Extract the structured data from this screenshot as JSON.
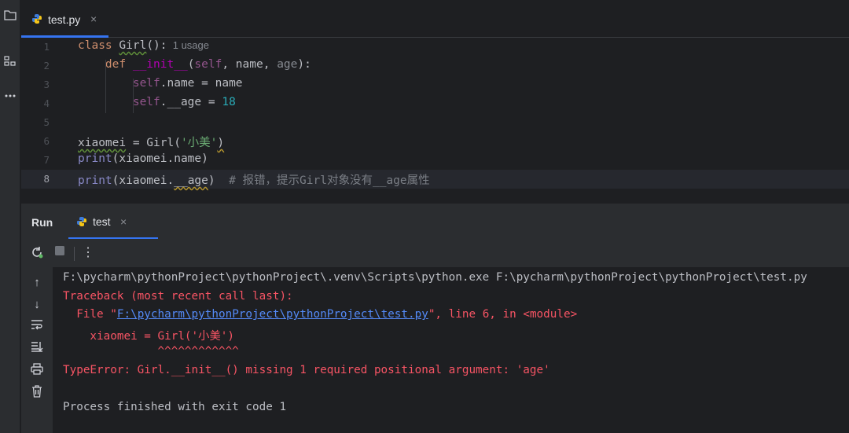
{
  "editor": {
    "tab": {
      "label": "test.py",
      "close": "×"
    },
    "lines": [
      {
        "num": "1",
        "parts": [
          {
            "t": "class ",
            "c": "kw"
          },
          {
            "t": "Girl",
            "c": "wavy-green"
          },
          {
            "t": "():",
            "c": ""
          },
          {
            "t": "  1 usage",
            "c": "hint"
          }
        ]
      },
      {
        "num": "2",
        "parts": [
          {
            "t": "    ",
            "c": ""
          },
          {
            "t": "def ",
            "c": "kw"
          },
          {
            "t": "__init__",
            "c": "dunder"
          },
          {
            "t": "(",
            "c": ""
          },
          {
            "t": "self",
            "c": "selfkw"
          },
          {
            "t": ", name, ",
            "c": ""
          },
          {
            "t": "age",
            "c": "unused"
          },
          {
            "t": "):",
            "c": ""
          }
        ]
      },
      {
        "num": "3",
        "parts": [
          {
            "t": "        ",
            "c": ""
          },
          {
            "t": "self",
            "c": "selfkw"
          },
          {
            "t": ".name = name",
            "c": ""
          }
        ]
      },
      {
        "num": "4",
        "parts": [
          {
            "t": "        ",
            "c": ""
          },
          {
            "t": "self",
            "c": "selfkw"
          },
          {
            "t": ".__age = ",
            "c": ""
          },
          {
            "t": "18",
            "c": "num"
          }
        ]
      },
      {
        "num": "5",
        "parts": []
      },
      {
        "num": "6",
        "parts": [
          {
            "t": "xiaomei",
            "c": "wavy-green"
          },
          {
            "t": " = Girl(",
            "c": ""
          },
          {
            "t": "'小美'",
            "c": "str"
          },
          {
            "t": ")",
            "c": "wavy-yellow"
          }
        ]
      },
      {
        "num": "7",
        "parts": [
          {
            "t": "print",
            "c": "builtin"
          },
          {
            "t": "(xiaomei.name)",
            "c": ""
          }
        ]
      },
      {
        "num": "8",
        "parts": [
          {
            "t": "print",
            "c": "builtin"
          },
          {
            "t": "(xiaomei.",
            "c": ""
          },
          {
            "t": "__age",
            "c": "wavy-yellow"
          },
          {
            "t": ")  ",
            "c": ""
          },
          {
            "t": "# 报错，提示Girl对象没有__age属性",
            "c": "comment"
          }
        ]
      }
    ],
    "current_line": 8
  },
  "run": {
    "title": "Run",
    "tab": {
      "label": "test",
      "close": "×"
    },
    "toolbar": {
      "rerun": "↻",
      "stop": "■",
      "more": "⋮"
    },
    "side": {
      "up": "↑",
      "down": "↓",
      "wrap": "⇌",
      "scroll_end": "⇊",
      "print": "⎙",
      "trash": "🗑"
    },
    "console": [
      {
        "parts": [
          {
            "t": "F:\\pycharm\\pythonProject\\pythonProject\\.venv\\Scripts\\python.exe F:\\pycharm\\pythonProject\\pythonProject\\test.py",
            "c": "c-normal"
          }
        ]
      },
      {
        "parts": [
          {
            "t": "Traceback (most recent call last):",
            "c": "c-err"
          }
        ]
      },
      {
        "parts": [
          {
            "t": "  File \"",
            "c": "c-err"
          },
          {
            "t": "F:\\pycharm\\pythonProject\\pythonProject\\test.py",
            "c": "c-link"
          },
          {
            "t": "\", line 6, in <module>",
            "c": "c-err"
          }
        ]
      },
      {
        "parts": [
          {
            "t": "    xiaomei = Girl('小美')",
            "c": "c-err"
          }
        ]
      },
      {
        "parts": [
          {
            "t": "              ^^^^^^^^^^^^",
            "c": "c-err"
          }
        ]
      },
      {
        "parts": [
          {
            "t": "TypeError: Girl.__init__() missing 1 required positional argument: 'age'",
            "c": "c-err"
          }
        ]
      },
      {
        "parts": [
          {
            "t": "",
            "c": "c-normal"
          }
        ]
      },
      {
        "parts": [
          {
            "t": "Process finished with exit code 1",
            "c": "c-normal"
          }
        ]
      }
    ]
  },
  "strip": {
    "folder": "folder-icon",
    "structure": "structure-icon",
    "more": "more-icon"
  },
  "colors": {
    "accent": "#3574f0",
    "error": "#f75464",
    "link": "#548af7",
    "keyword": "#cf8e6d",
    "string": "#6aab73"
  }
}
